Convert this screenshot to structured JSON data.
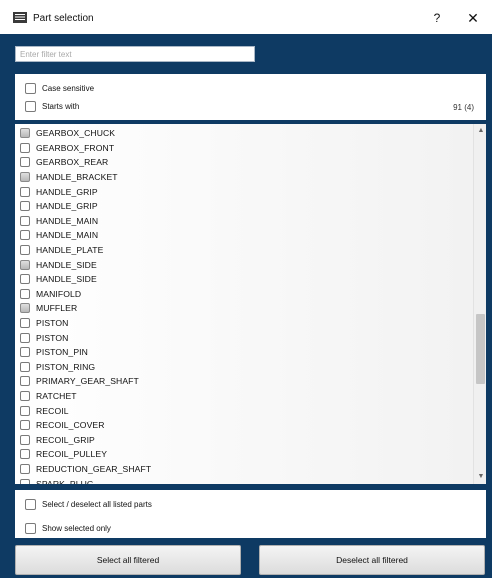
{
  "window": {
    "title": "Part selection",
    "help_label": "?",
    "close_label": "✕"
  },
  "filter": {
    "placeholder": "Enter filter text",
    "value": ""
  },
  "options": {
    "case_sensitive_label": "Case sensitive",
    "starts_with_label": "Starts with",
    "count": "91 (4)"
  },
  "parts": [
    {
      "label": "GEARBOX_CHUCK",
      "state": "partial"
    },
    {
      "label": "GEARBOX_FRONT",
      "state": "unchecked"
    },
    {
      "label": "GEARBOX_REAR",
      "state": "unchecked"
    },
    {
      "label": "HANDLE_BRACKET",
      "state": "partial"
    },
    {
      "label": "HANDLE_GRIP",
      "state": "unchecked"
    },
    {
      "label": "HANDLE_GRIP",
      "state": "unchecked"
    },
    {
      "label": "HANDLE_MAIN",
      "state": "unchecked"
    },
    {
      "label": "HANDLE_MAIN",
      "state": "unchecked"
    },
    {
      "label": "HANDLE_PLATE",
      "state": "unchecked"
    },
    {
      "label": "HANDLE_SIDE",
      "state": "partial"
    },
    {
      "label": "HANDLE_SIDE",
      "state": "unchecked"
    },
    {
      "label": "MANIFOLD",
      "state": "unchecked"
    },
    {
      "label": "MUFFLER",
      "state": "partial"
    },
    {
      "label": "PISTON",
      "state": "unchecked"
    },
    {
      "label": "PISTON",
      "state": "unchecked"
    },
    {
      "label": "PISTON_PIN",
      "state": "unchecked"
    },
    {
      "label": "PISTON_RING",
      "state": "unchecked"
    },
    {
      "label": "PRIMARY_GEAR_SHAFT",
      "state": "unchecked"
    },
    {
      "label": "RATCHET",
      "state": "unchecked"
    },
    {
      "label": "RECOIL",
      "state": "unchecked"
    },
    {
      "label": "RECOIL_COVER",
      "state": "unchecked"
    },
    {
      "label": "RECOIL_GRIP",
      "state": "unchecked"
    },
    {
      "label": "RECOIL_PULLEY",
      "state": "unchecked"
    },
    {
      "label": "REDUCTION_GEAR_SHAFT",
      "state": "unchecked"
    },
    {
      "label": "SPARK_PLUG",
      "state": "unchecked"
    }
  ],
  "bottom": {
    "select_all_listed_label": "Select / deselect all listed parts",
    "show_selected_only_label": "Show selected only"
  },
  "buttons": {
    "select_all_filtered": "Select all filtered",
    "deselect_all_filtered": "Deselect all filtered"
  },
  "icons": {
    "app": "list-window-icon",
    "help": "help-icon",
    "close": "close-icon",
    "scroll_up": "scroll-up-arrow-icon",
    "scroll_down": "scroll-down-arrow-icon"
  },
  "colors": {
    "background": "#0e3a63",
    "panel": "#ffffff"
  }
}
